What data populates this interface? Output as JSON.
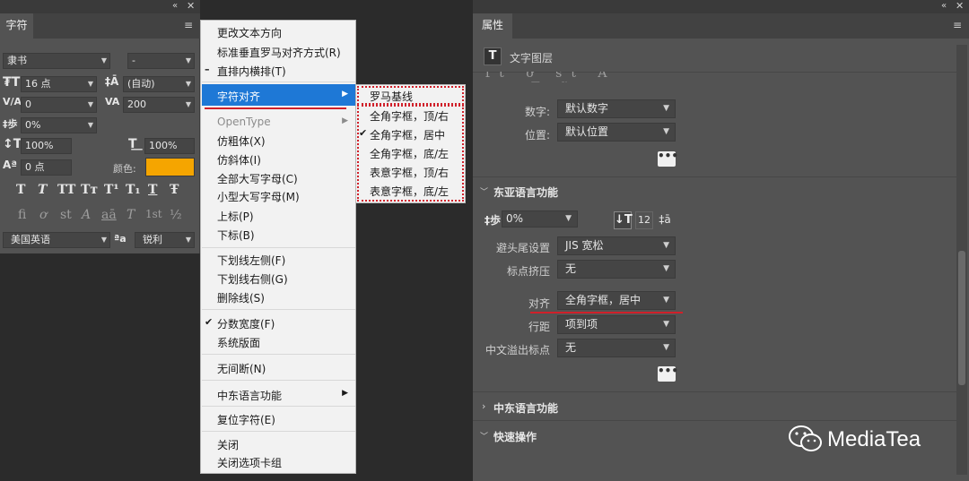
{
  "character_panel": {
    "tab": "字符",
    "font_family": "隶书",
    "font_style": "-",
    "font_size": "16 点",
    "leading": "(自动)",
    "kerning": "0",
    "tracking": "200",
    "tsume": "0%",
    "vertical_scale": "100%",
    "horizontal_scale": "100%",
    "baseline_shift": "0 点",
    "color_label": "颜色:",
    "color_value": "#f5a500",
    "style_glyphs": [
      "T",
      "T",
      "TT",
      "Tт",
      "T¹",
      "T₁",
      "T",
      "Ŧ"
    ],
    "opentype_glyphs": [
      "fi",
      "ơ",
      "st",
      "A",
      "aā",
      "T",
      "1st",
      "½"
    ],
    "language": "美国英语",
    "aa_icon": "ªa",
    "antialias": "锐利"
  },
  "context_menu": {
    "items": [
      "更改文本方向",
      "标准垂直罗马对齐方式(R)",
      "直排内横排(T)",
      "字符对齐",
      "OpenType",
      "仿粗体(X)",
      "仿斜体(I)",
      "全部大写字母(C)",
      "小型大写字母(M)",
      "上标(P)",
      "下标(B)",
      "下划线左侧(F)",
      "下划线右侧(G)",
      "删除线(S)",
      "分数宽度(F)",
      "系统版面",
      "无间断(N)",
      "中东语言功能",
      "复位字符(E)",
      "关闭",
      "关闭选项卡组"
    ],
    "dash_mark": "–",
    "check_mark": "✔"
  },
  "submenu": {
    "items": [
      "罗马基线",
      "全角字框，顶/右",
      "全角字框，居中",
      "全角字框，底/左",
      "表意字框，顶/右",
      "表意字框，底/左"
    ],
    "check_mark": "✔"
  },
  "properties_panel": {
    "tab": "属性",
    "layer_type": "文字图层",
    "numbers_label": "数字:",
    "numbers_value": "默认数字",
    "position_label": "位置:",
    "position_value": "默认位置",
    "more_glyph": "•••",
    "east_asian_title": "东亚语言功能",
    "tsume_value": "0%",
    "kinsoku_label": "避头尾设置",
    "kinsoku_value": "JIS 宽松",
    "mojikumi_label": "标点挤压",
    "mojikumi_value": "无",
    "align_label": "对齐",
    "align_value": "全角字框，居中",
    "line_label": "行距",
    "line_value": "项到项",
    "hanging_label": "中文溢出标点",
    "hanging_value": "无",
    "middle_east_title": "中东语言功能",
    "quick_actions_title": "快速操作"
  },
  "watermark": "MediaTea"
}
